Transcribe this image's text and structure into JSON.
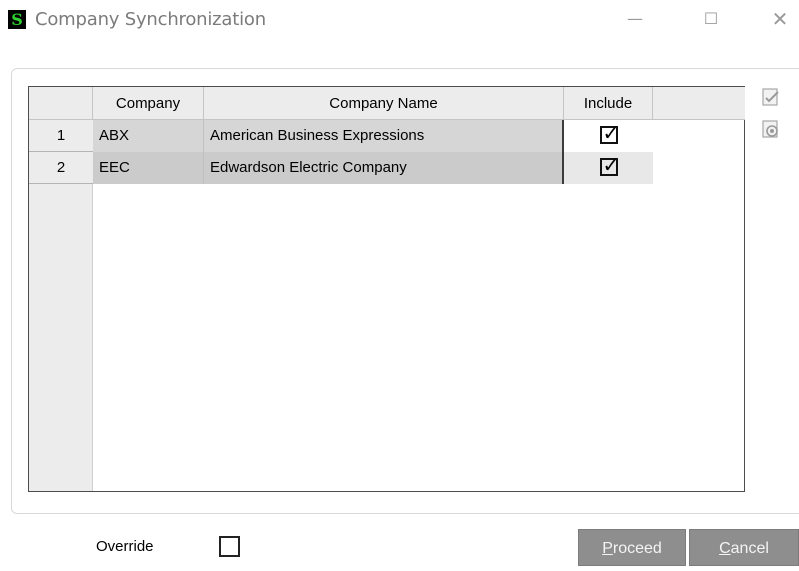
{
  "window": {
    "title": "Company Synchronization",
    "icon_letter": "S",
    "minimize_glyph": "—",
    "maximize_glyph": "☐",
    "close_glyph": "✕"
  },
  "grid": {
    "columns": [
      "Company",
      "Company Name",
      "Include"
    ],
    "rows": [
      {
        "num": "1",
        "company": "ABX",
        "name": "American Business Expressions",
        "include": true
      },
      {
        "num": "2",
        "company": "EEC",
        "name": "Edwardson Electric Company",
        "include": true
      }
    ]
  },
  "side_icons": [
    "check-all-icon",
    "clear-all-icon"
  ],
  "footer": {
    "override_label": "Override",
    "override_checked": false,
    "proceed_underlined": "P",
    "proceed_rest": "roceed",
    "cancel_underlined": "C",
    "cancel_rest": "ancel"
  },
  "colors": {
    "app_icon_bg": "#000000",
    "app_icon_fg": "#2fd12f",
    "button_bg": "#8e8e8e",
    "cell_bg": "#d6d6d6"
  }
}
